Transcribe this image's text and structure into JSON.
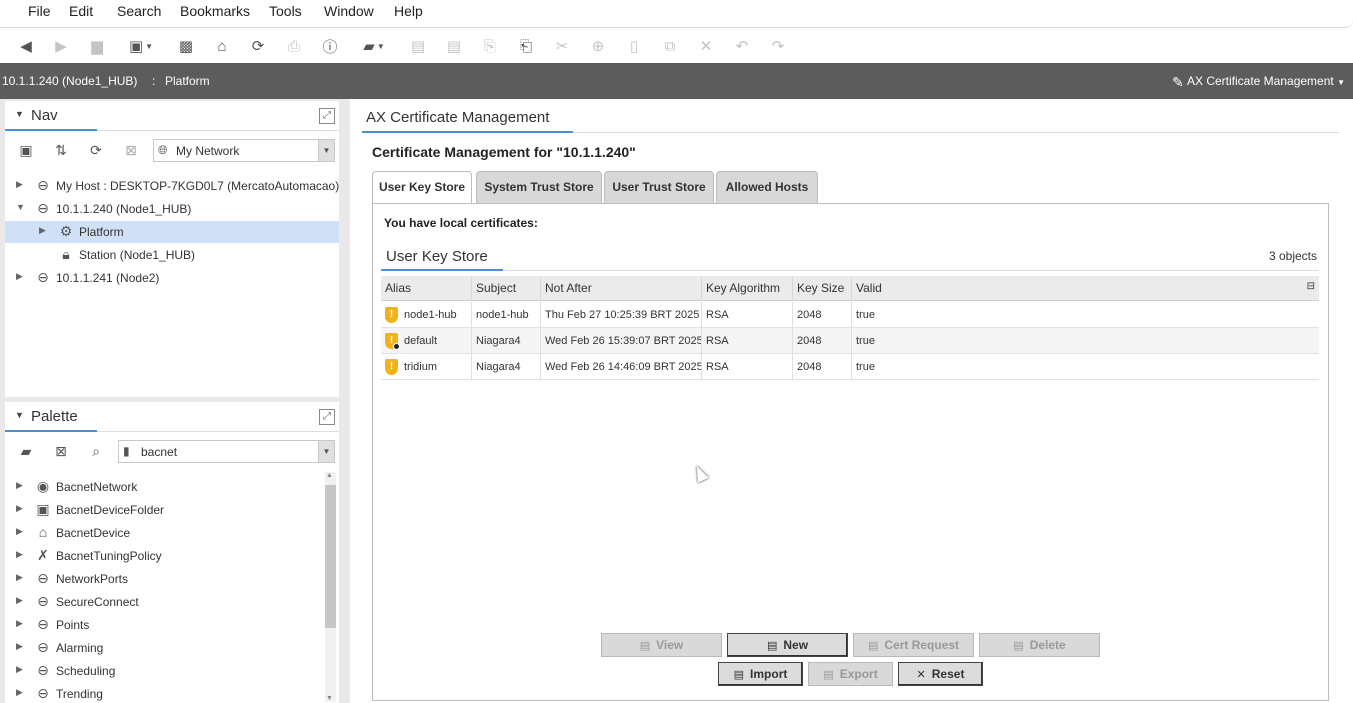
{
  "menu": [
    "File",
    "Edit",
    "Search",
    "Bookmarks",
    "Tools",
    "Window",
    "Help"
  ],
  "toolbar": {
    "icons": [
      "back-icon",
      "forward-icon",
      "folder-up-icon",
      "window-icon",
      "open-folder-icon",
      "home-icon",
      "refresh-icon",
      "save-icon",
      "info-icon",
      "open-icon",
      "save-all-icon",
      "save-as-icon",
      "import-icon",
      "export-icon",
      "cut-icon",
      "copy-icon",
      "paste-icon",
      "duplicate-icon",
      "delete-icon",
      "undo-icon",
      "redo-icon"
    ]
  },
  "pathbar": {
    "host": "10.1.1.240 (Node1_HUB)",
    "separator": ":",
    "platform": "Platform",
    "view_name": "AX Certificate Management"
  },
  "nav": {
    "title": "Nav",
    "network_selector": "My Network",
    "tree": [
      {
        "label": "My Host : DESKTOP-7KGD0L7 (MercatoAutomacao)",
        "expanded": false
      },
      {
        "label": "10.1.1.240 (Node1_HUB)",
        "expanded": true
      },
      {
        "label": "Platform",
        "selected": true
      },
      {
        "label": "Station (Node1_HUB)"
      },
      {
        "label": "10.1.1.241 (Node2)",
        "expanded": false
      }
    ]
  },
  "palette": {
    "title": "Palette",
    "module_selector": "bacnet",
    "items": [
      "BacnetNetwork",
      "BacnetDeviceFolder",
      "BacnetDevice",
      "BacnetTuningPolicy",
      "NetworkPorts",
      "SecureConnect",
      "Points",
      "Alarming",
      "Scheduling",
      "Trending"
    ],
    "scroll_fraction": 0.0
  },
  "main": {
    "view_title": "AX Certificate Management",
    "heading": "Certificate Management for \"10.1.1.240\"",
    "tabs": [
      "User Key Store",
      "System Trust Store",
      "User Trust Store",
      "Allowed Hosts"
    ],
    "active_tab": "User Key Store",
    "local_notice": "You have local certificates:",
    "store_title": "User Key Store",
    "object_count": "3 objects",
    "columns": [
      "Alias",
      "Subject",
      "Not After",
      "Key Algorithm",
      "Key Size",
      "Valid"
    ],
    "rows": [
      {
        "alias": "node1-hub",
        "subject": "node1-hub",
        "not_after": "Thu Feb 27 10:25:39 BRT 2025",
        "algorithm": "RSA",
        "key_size": "2048",
        "valid": "true",
        "icon": "warning-shield-icon"
      },
      {
        "alias": "default",
        "subject": "Niagara4",
        "not_after": "Wed Feb 26 15:39:07 BRT 2025",
        "algorithm": "RSA",
        "key_size": "2048",
        "valid": "true",
        "icon": "warning-shield-default-icon"
      },
      {
        "alias": "tridium",
        "subject": "Niagara4",
        "not_after": "Wed Feb 26 14:46:09 BRT 2025",
        "algorithm": "RSA",
        "key_size": "2048",
        "valid": "true",
        "icon": "warning-shield-icon"
      }
    ],
    "buttons": {
      "view": "View",
      "new": "New",
      "cert_request": "Cert Request",
      "delete": "Delete",
      "import": "Import",
      "export": "Export",
      "reset": "Reset"
    }
  }
}
